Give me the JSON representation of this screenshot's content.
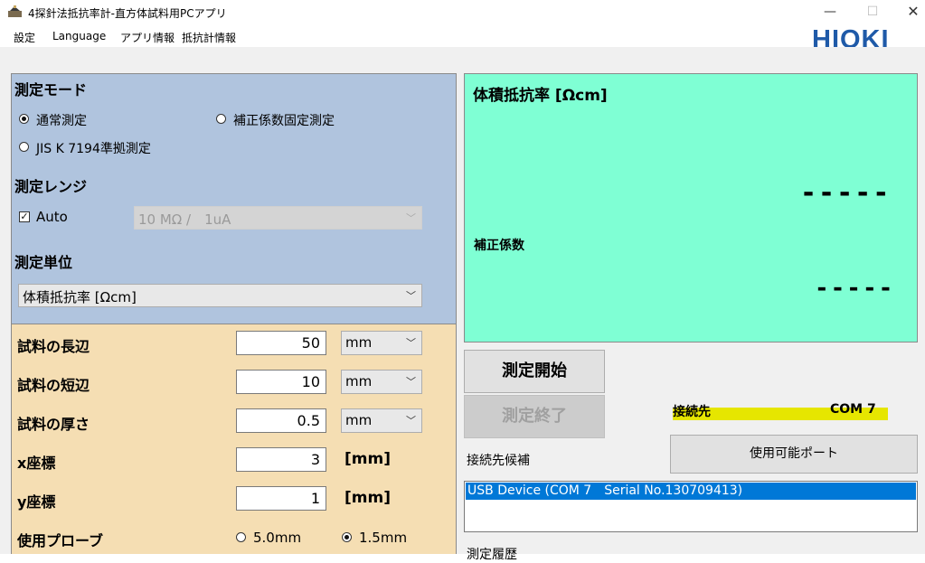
{
  "window": {
    "title": "4探針法抵抗率計-直方体試料用PCアプリ",
    "minimize": "—",
    "maximize": "☐",
    "close": "✕"
  },
  "menu": {
    "items": [
      "設定",
      "Language",
      "アプリ情報",
      "抵抗計情報"
    ]
  },
  "logo": "HIOKI",
  "colors": {
    "brand": "#1f5aa8",
    "mode_panel": "#b0c4de",
    "sample_panel": "#f5deb3",
    "result_panel": "#7fffd4",
    "connection_highlight": "#e6e600",
    "selection": "#0078d7"
  },
  "measure_mode": {
    "title": "測定モード",
    "options": [
      {
        "label": "通常測定",
        "selected": true
      },
      {
        "label": "補正係数固定測定",
        "selected": false
      },
      {
        "label": "JIS K 7194準拠測定",
        "selected": false
      }
    ]
  },
  "measure_range": {
    "title": "測定レンジ",
    "auto_label": "Auto",
    "auto_checked": true,
    "range_value": "10 MΩ /　1uA"
  },
  "measure_unit": {
    "title": "測定単位",
    "value": "体積抵抗率 [Ωcm]"
  },
  "sample": {
    "rows": [
      {
        "label": "試料の長辺",
        "value": "50",
        "unit": "mm"
      },
      {
        "label": "試料の短辺",
        "value": "10",
        "unit": "mm"
      },
      {
        "label": "試料の厚さ",
        "value": "0.5",
        "unit": "mm"
      }
    ],
    "coords": [
      {
        "label": "x座標",
        "value": "3",
        "unit": "[mm]"
      },
      {
        "label": "y座標",
        "value": "1",
        "unit": "[mm]"
      }
    ],
    "probe": {
      "label": "使用プローブ",
      "options": [
        {
          "label": "5.0mm",
          "selected": false
        },
        {
          "label": "1.5mm",
          "selected": true
        }
      ]
    }
  },
  "result": {
    "title": "体積抵抗率 [Ωcm]",
    "value": "-----",
    "correction_label": "補正係数",
    "correction_value": "-----"
  },
  "controls": {
    "start_label": "測定開始",
    "stop_label": "測定終了"
  },
  "connection": {
    "label": "接続先",
    "port": "COM 7",
    "ports_button": "使用可能ポート",
    "candidates_label": "接続先候補",
    "candidates": [
      "USB Device (COM 7　Serial No.130709413)"
    ],
    "next_label": "測定履歴"
  }
}
